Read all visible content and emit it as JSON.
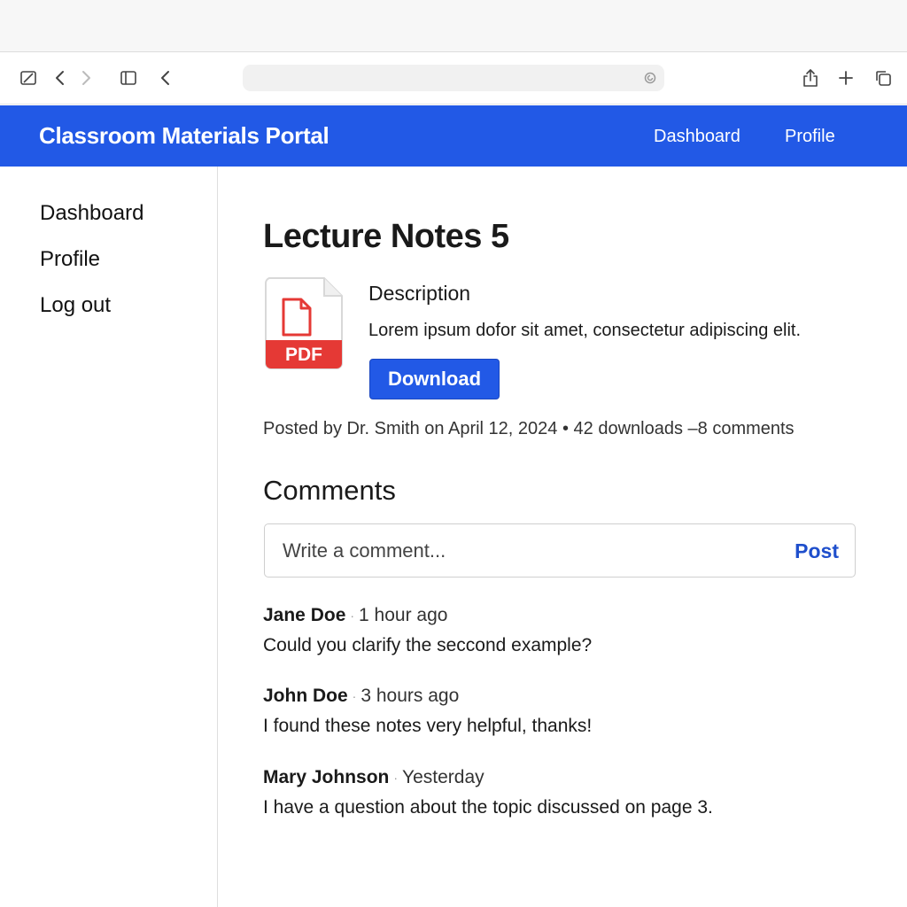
{
  "browser": {
    "address_value": "",
    "icons": [
      "sidebar-toggle-icon",
      "back-icon",
      "forward-icon",
      "tabs-icon",
      "back-icon",
      "reload-icon",
      "share-icon",
      "new-tab-icon",
      "tab-overview-icon"
    ]
  },
  "header": {
    "title": "Classroom Materials Portal",
    "nav": [
      {
        "label": "Dashboard"
      },
      {
        "label": "Profile"
      }
    ],
    "color": "#2259e6"
  },
  "sidebar": {
    "items": [
      {
        "label": "Dashboard"
      },
      {
        "label": "Profile"
      },
      {
        "label": "Log out"
      }
    ]
  },
  "material": {
    "title": "Lecture Notes 5",
    "file_type": "PDF",
    "description_heading": "Description",
    "description": "Lorem ipsum dofor sit amet, consectetur adipiscing elit.",
    "download_label": "Download",
    "meta": "Posted by Dr. Smith on April 12, 2024 • 42 downloads –8 comments"
  },
  "comments": {
    "heading": "Comments",
    "input_placeholder": "Write a comment...",
    "post_label": "Post",
    "separator": "·",
    "items": [
      {
        "author": "Jane Doe",
        "time": "1 hour ago",
        "text": "Could you clarify the seccond example?"
      },
      {
        "author": "John Doe",
        "time": "3 hours ago",
        "text": "I found these notes very helpful, thanks!"
      },
      {
        "author": "Mary Johnson",
        "time": "Yesterday",
        "text": "I have a question about the topic discussed on page 3."
      }
    ]
  }
}
